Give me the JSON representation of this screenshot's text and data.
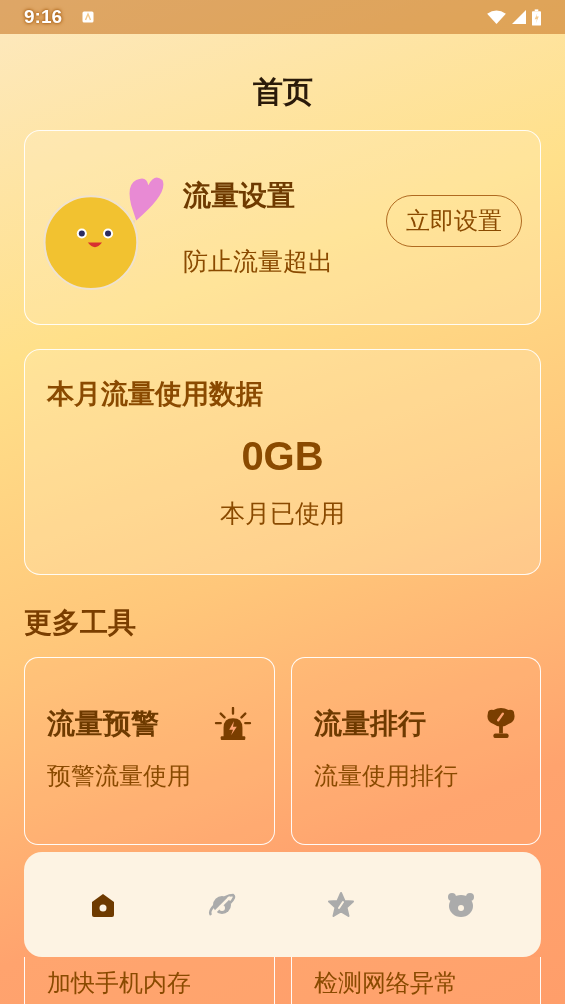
{
  "status_bar": {
    "time": "9:16"
  },
  "header": {
    "title": "首页"
  },
  "promo_card": {
    "title": "流量设置",
    "subtitle": "防止流量超出",
    "button": "立即设置"
  },
  "usage_card": {
    "title": "本月流量使用数据",
    "amount": "0GB",
    "caption": "本月已使用"
  },
  "tools_section": {
    "title": "更多工具"
  },
  "tools": [
    {
      "kind": "alarm",
      "title": "流量预警",
      "subtitle": "预警流量使用"
    },
    {
      "kind": "trophy",
      "title": "流量排行",
      "subtitle": "流量使用排行"
    },
    {
      "subtitle": "加快手机内存"
    },
    {
      "subtitle": "检测网络异常"
    }
  ],
  "bottom_nav": [
    {
      "kind": "home",
      "selected": true
    },
    {
      "kind": "planet",
      "selected": false
    },
    {
      "kind": "star",
      "selected": false
    },
    {
      "kind": "bear",
      "selected": false
    }
  ]
}
